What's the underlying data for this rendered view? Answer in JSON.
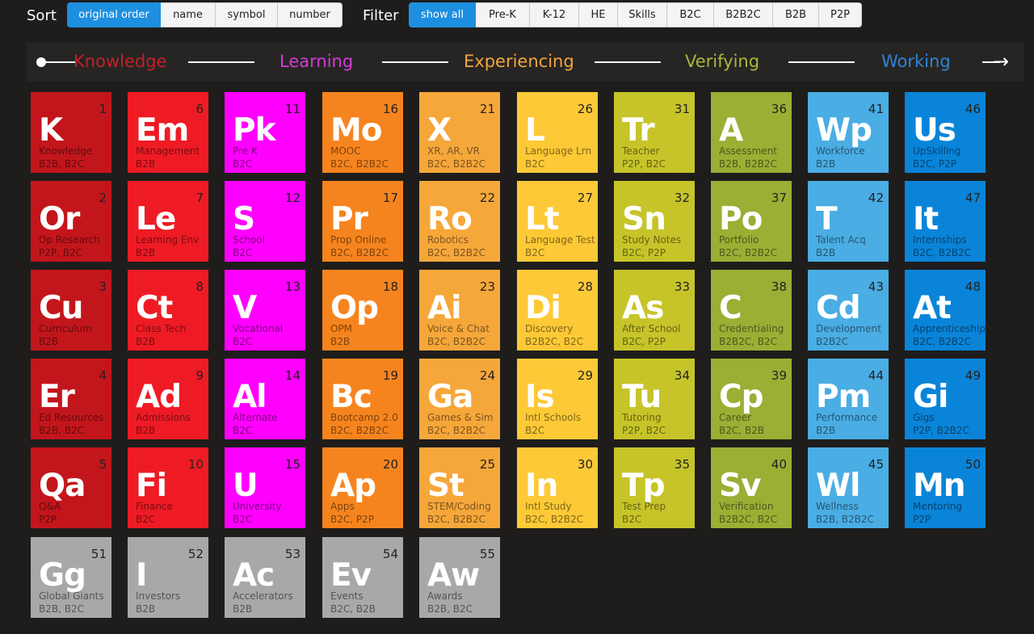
{
  "sort": {
    "label": "Sort",
    "options": [
      "original order",
      "name",
      "symbol",
      "number"
    ],
    "active": 0
  },
  "filter": {
    "label": "Filter",
    "options": [
      "show all",
      "Pre-K",
      "K-12",
      "HE",
      "Skills",
      "B2C",
      "B2B2C",
      "B2B",
      "P2P"
    ],
    "active": 0
  },
  "stages": [
    {
      "label": "Knowledge",
      "color": "#c02127"
    },
    {
      "label": "Learning",
      "color": "#d63bd8"
    },
    {
      "label": "Experiencing",
      "color": "#f4a53a"
    },
    {
      "label": "Verifying",
      "color": "#a9b73c"
    },
    {
      "label": "Working",
      "color": "#2f83d4"
    }
  ],
  "stage_arrow_icon": "arrow-right-icon",
  "column_colors": [
    "#c3161c",
    "#ee1b24",
    "#ff00ff",
    "#f6841e",
    "#f6a73a",
    "#fdc936",
    "#c6c429",
    "#9cae34",
    "#4aade3",
    "#0a84d8",
    "#a8a8a8"
  ],
  "elements": [
    {
      "n": 1,
      "sym": "K",
      "name": "Knowledge",
      "tags": "B2B, B2C"
    },
    {
      "n": 2,
      "sym": "Or",
      "name": "Op Research",
      "tags": "P2P, B2C"
    },
    {
      "n": 3,
      "sym": "Cu",
      "name": "Curriculum",
      "tags": "B2B"
    },
    {
      "n": 4,
      "sym": "Er",
      "name": "Ed Resources",
      "tags": "B2B, B2C"
    },
    {
      "n": 5,
      "sym": "Qa",
      "name": "Q&A",
      "tags": "P2P"
    },
    {
      "n": 6,
      "sym": "Em",
      "name": "Management",
      "tags": "B2B"
    },
    {
      "n": 7,
      "sym": "Le",
      "name": "Learning Env",
      "tags": "B2B"
    },
    {
      "n": 8,
      "sym": "Ct",
      "name": "Class Tech",
      "tags": "B2B"
    },
    {
      "n": 9,
      "sym": "Ad",
      "name": "Admissions",
      "tags": "B2B"
    },
    {
      "n": 10,
      "sym": "Fi",
      "name": "Finance",
      "tags": "B2C"
    },
    {
      "n": 11,
      "sym": "Pk",
      "name": "Pre K",
      "tags": "B2C"
    },
    {
      "n": 12,
      "sym": "S",
      "name": "School",
      "tags": "B2C"
    },
    {
      "n": 13,
      "sym": "V",
      "name": "Vocational",
      "tags": "B2C"
    },
    {
      "n": 14,
      "sym": "Al",
      "name": "Alternate",
      "tags": "B2C"
    },
    {
      "n": 15,
      "sym": "U",
      "name": "University",
      "tags": "B2C"
    },
    {
      "n": 16,
      "sym": "Mo",
      "name": "MOOC",
      "tags": "B2C, B2B2C"
    },
    {
      "n": 17,
      "sym": "Pr",
      "name": "Prop Online",
      "tags": "B2C, B2B2C"
    },
    {
      "n": 18,
      "sym": "Op",
      "name": "OPM",
      "tags": "B2B"
    },
    {
      "n": 19,
      "sym": "Bc",
      "name": "Bootcamp 2.0",
      "tags": "B2C, B2B2C"
    },
    {
      "n": 20,
      "sym": "Ap",
      "name": "Apps",
      "tags": "B2C, P2P"
    },
    {
      "n": 21,
      "sym": "X",
      "name": "XR, AR, VR",
      "tags": "B2C, B2B2C"
    },
    {
      "n": 22,
      "sym": "Ro",
      "name": "Robotics",
      "tags": "B2C, B2B2C"
    },
    {
      "n": 23,
      "sym": "Ai",
      "name": "Voice & Chat",
      "tags": "B2C, B2B2C"
    },
    {
      "n": 24,
      "sym": "Ga",
      "name": "Games & Sim",
      "tags": "B2C, B2B2C"
    },
    {
      "n": 25,
      "sym": "St",
      "name": "STEM/Coding",
      "tags": "B2C, B2B2C"
    },
    {
      "n": 26,
      "sym": "L",
      "name": "Language Lrn",
      "tags": "B2C"
    },
    {
      "n": 27,
      "sym": "Lt",
      "name": "Language Test",
      "tags": "B2C"
    },
    {
      "n": 28,
      "sym": "Di",
      "name": "Discovery",
      "tags": "B2B2C, B2C"
    },
    {
      "n": 29,
      "sym": "Is",
      "name": "Intl Schools",
      "tags": "B2C"
    },
    {
      "n": 30,
      "sym": "In",
      "name": "Intl Study",
      "tags": "B2C, B2B2C"
    },
    {
      "n": 31,
      "sym": "Tr",
      "name": "Teacher",
      "tags": "P2P, B2C"
    },
    {
      "n": 32,
      "sym": "Sn",
      "name": "Study Notes",
      "tags": "B2C, P2P"
    },
    {
      "n": 33,
      "sym": "As",
      "name": "After School",
      "tags": "B2C, P2P"
    },
    {
      "n": 34,
      "sym": "Tu",
      "name": "Tutoring",
      "tags": "P2P, B2C"
    },
    {
      "n": 35,
      "sym": "Tp",
      "name": "Test Prep",
      "tags": "B2C"
    },
    {
      "n": 36,
      "sym": "A",
      "name": "Assessment",
      "tags": "B2B, B2B2C"
    },
    {
      "n": 37,
      "sym": "Po",
      "name": "Portfolio",
      "tags": "B2C, B2B2C"
    },
    {
      "n": 38,
      "sym": "C",
      "name": "Credentialing",
      "tags": "B2B2C, B2C"
    },
    {
      "n": 39,
      "sym": "Cp",
      "name": "Career",
      "tags": "B2C, B2B"
    },
    {
      "n": 40,
      "sym": "Sv",
      "name": "Verification",
      "tags": "B2B2C, B2C"
    },
    {
      "n": 41,
      "sym": "Wp",
      "name": "Workforce",
      "tags": "B2B"
    },
    {
      "n": 42,
      "sym": "T",
      "name": "Talent Acq",
      "tags": "B2B"
    },
    {
      "n": 43,
      "sym": "Cd",
      "name": "Development",
      "tags": "B2B2C"
    },
    {
      "n": 44,
      "sym": "Pm",
      "name": "Performance",
      "tags": "B2B"
    },
    {
      "n": 45,
      "sym": "Wl",
      "name": "Wellness",
      "tags": "B2B, B2B2C"
    },
    {
      "n": 46,
      "sym": "Us",
      "name": "UpSkilling",
      "tags": "B2C, P2P"
    },
    {
      "n": 47,
      "sym": "It",
      "name": "Internships",
      "tags": "B2C, B2B2C"
    },
    {
      "n": 48,
      "sym": "At",
      "name": "Apprenticeship",
      "tags": "B2C, B2B2C"
    },
    {
      "n": 49,
      "sym": "Gi",
      "name": "Gigs",
      "tags": "P2P, B2B2C"
    },
    {
      "n": 50,
      "sym": "Mn",
      "name": "Mentoring",
      "tags": "P2P"
    },
    {
      "n": 51,
      "sym": "Gg",
      "name": "Global Giants",
      "tags": "B2B, B2C"
    },
    {
      "n": 52,
      "sym": "I",
      "name": "Investors",
      "tags": "B2B"
    },
    {
      "n": 53,
      "sym": "Ac",
      "name": "Accelerators",
      "tags": "B2B"
    },
    {
      "n": 54,
      "sym": "Ev",
      "name": "Events",
      "tags": "B2C, B2B"
    },
    {
      "n": 55,
      "sym": "Aw",
      "name": "Awards",
      "tags": "B2B, B2C"
    }
  ]
}
